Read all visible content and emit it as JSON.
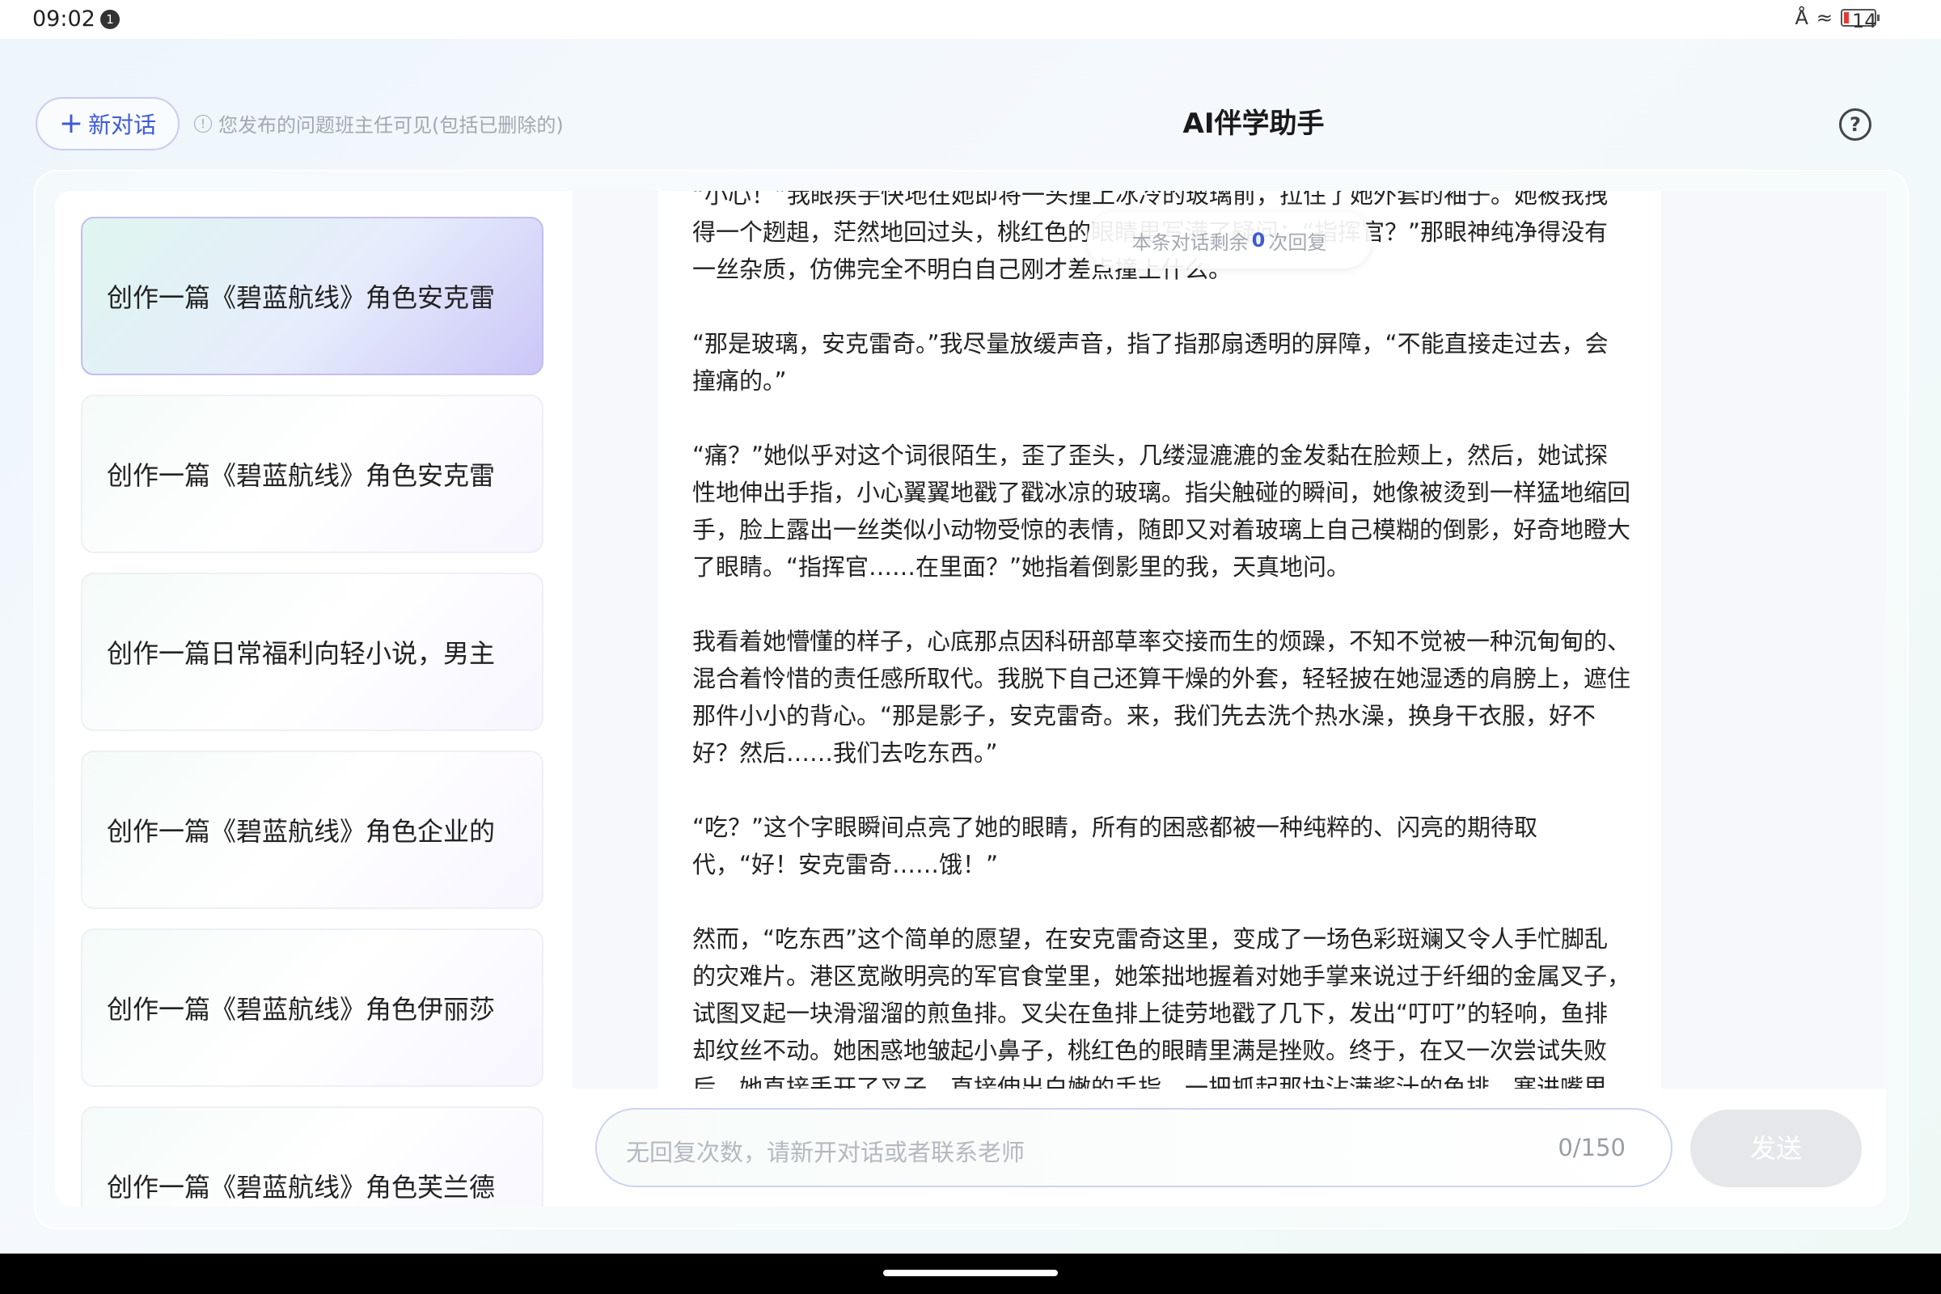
{
  "status": {
    "time": "09:02",
    "notification_count": "1",
    "battery": "14"
  },
  "header": {
    "new_chat_label": "新对话",
    "notice": "您发布的问题班主任可见(包括已删除的)",
    "title": "AI伴学助手"
  },
  "sidebar": {
    "items": [
      {
        "label": "创作一篇《碧蓝航线》角色安克雷",
        "active": true
      },
      {
        "label": "创作一篇《碧蓝航线》角色安克雷",
        "active": false
      },
      {
        "label": "创作一篇日常福利向轻小说，男主",
        "active": false
      },
      {
        "label": "创作一篇《碧蓝航线》角色企业的",
        "active": false
      },
      {
        "label": "创作一篇《碧蓝航线》角色伊丽莎",
        "active": false
      },
      {
        "label": "创作一篇《碧蓝航线》角色芙兰德",
        "active": false
      }
    ]
  },
  "remaining": {
    "prefix": "本条对话剩余",
    "count": "0",
    "suffix": "次回复"
  },
  "message": {
    "paragraphs": [
      "“小心！”我眼疾手快地在她即将一头撞上冰冷的玻璃前，拉住了她外套的袖子。她被我拽得一个趔趄，茫然地回过头，桃红色的眼睛里写满了疑问：“指挥官？”那眼神纯净得没有一丝杂质，仿佛完全不明白自己刚才差点撞上什么。",
      "“那是玻璃，安克雷奇。”我尽量放缓声音，指了指那扇透明的屏障，“不能直接走过去，会撞痛的。”",
      "“痛？”她似乎对这个词很陌生，歪了歪头，几缕湿漉漉的金发黏在脸颊上，然后，她试探性地伸出手指，小心翼翼地戳了戳冰凉的玻璃。指尖触碰的瞬间，她像被烫到一样猛地缩回手，脸上露出一丝类似小动物受惊的表情，随即又对着玻璃上自己模糊的倒影，好奇地瞪大了眼睛。“指挥官……在里面？”她指着倒影里的我，天真地问。",
      "我看着她懵懂的样子，心底那点因科研部草率交接而生的烦躁，不知不觉被一种沉甸甸的、混合着怜惜的责任感所取代。我脱下自己还算干燥的外套，轻轻披在她湿透的肩膀上，遮住那件小小的背心。“那是影子，安克雷奇。来，我们先去洗个热水澡，换身干衣服，好不好？然后……我们去吃东西。”",
      "“吃？”这个字眼瞬间点亮了她的眼睛，所有的困惑都被一种纯粹的、闪亮的期待取代，“好！安克雷奇……饿！”",
      "然而，“吃东西”这个简单的愿望，在安克雷奇这里，变成了一场色彩斑斓又令人手忙脚乱的灾难片。港区宽敞明亮的军官食堂里，她笨拙地握着对她手掌来说过于纤细的金属叉子，试图叉起一块滑溜溜的煎鱼排。叉尖在鱼排上徒劳地戳了几下，发出“叮叮”的轻响，鱼排却纹丝不动。她困惑地皱起小鼻子，桃红色的眼睛里满是挫败。终于，在又一次尝试失败后，她直接丢开了叉子，直接伸出白嫩的手指，一把抓起那块沾满酱汁的鱼排，塞进嘴里。"
    ]
  },
  "input": {
    "placeholder": "无回复次数，请新开对话或者联系老师",
    "counter": "0/150",
    "send_label": "发送"
  }
}
